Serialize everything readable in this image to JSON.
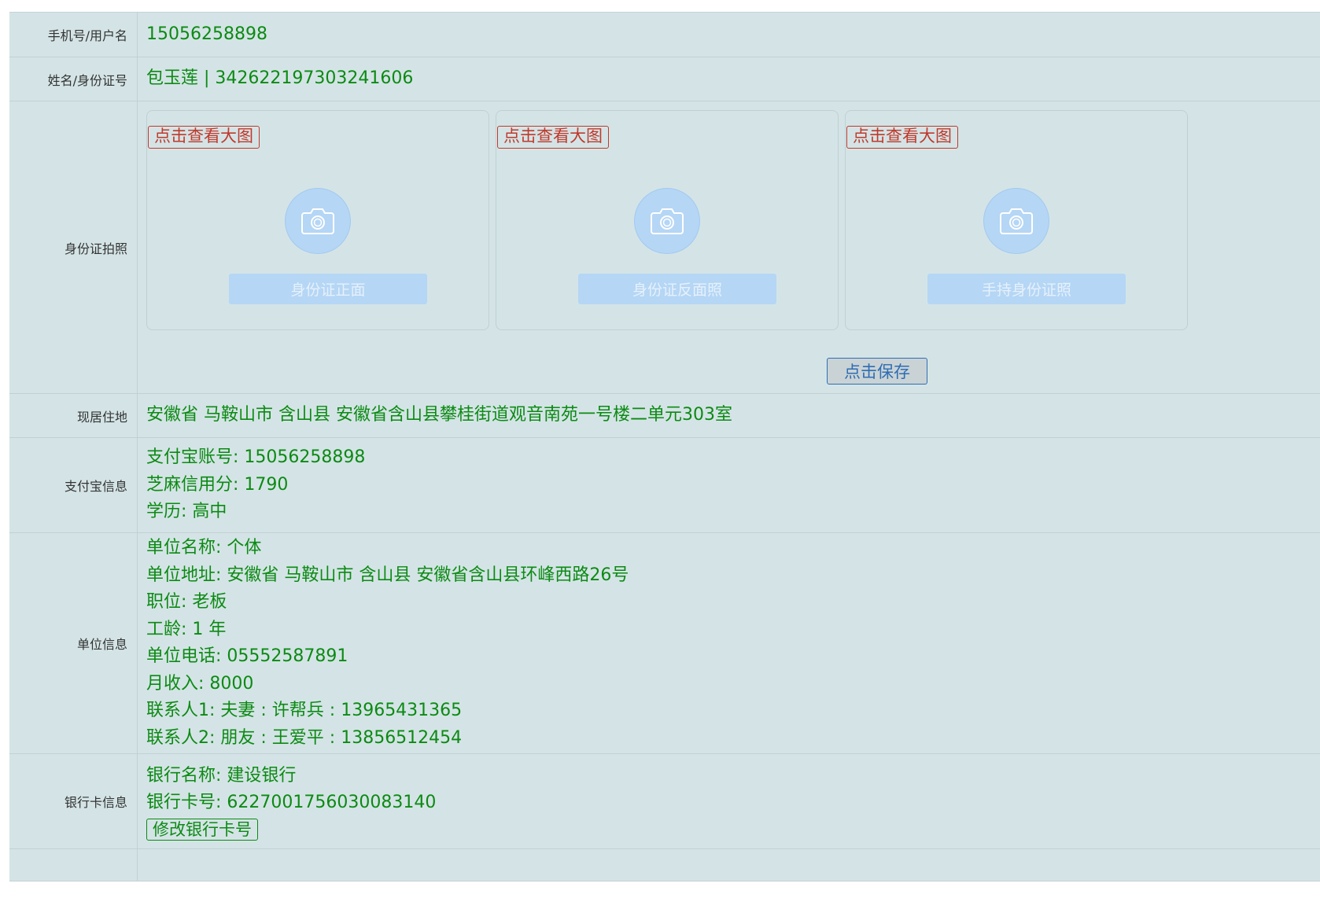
{
  "rows": {
    "phone": {
      "label": "手机号/用户名",
      "value": "15056258898"
    },
    "name": {
      "label": "姓名/身份证号",
      "value": "包玉莲 | 342622197303241606"
    },
    "photos": {
      "label": "身份证拍照",
      "cards": [
        {
          "view": "点击查看大图",
          "upload": "身份证正面"
        },
        {
          "view": "点击查看大图",
          "upload": "身份证反面照"
        },
        {
          "view": "点击查看大图",
          "upload": "手持身份证照"
        }
      ],
      "save": "点击保存"
    },
    "address": {
      "label": "现居住地",
      "value": "安徽省 马鞍山市 含山县 安徽省含山县攀桂街道观音南苑一号楼二单元303室"
    },
    "alipay": {
      "label": "支付宝信息",
      "lines": [
        "支付宝账号: 15056258898",
        "芝麻信用分: 1790",
        "学历: 高中"
      ]
    },
    "work": {
      "label": "单位信息",
      "lines": [
        "单位名称: 个体",
        "单位地址: 安徽省 马鞍山市 含山县 安徽省含山县环峰西路26号",
        "职位: 老板",
        "工龄: 1 年",
        "单位电话: 05552587891",
        "月收入: 8000",
        "联系人1: 夫妻 : 许帮兵 : 13965431365",
        "联系人2: 朋友 : 王爱平 : 13856512454"
      ]
    },
    "bank": {
      "label": "银行卡信息",
      "lines": [
        "银行名称: 建设银行",
        "银行卡号: 6227001756030083140"
      ],
      "edit": "修改银行卡号"
    }
  },
  "colors": {
    "value_text": "#0c8a13",
    "danger": "#c0392b",
    "upload_bg": "#b5d6f5",
    "row_bg": "#d4e4e6"
  }
}
